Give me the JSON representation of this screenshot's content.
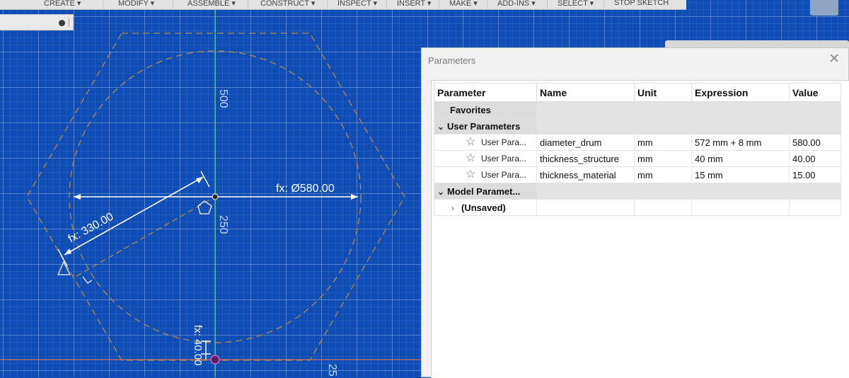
{
  "toolbar": {
    "menus": [
      "CREATE ▾",
      "MODIFY ▾",
      "ASSEMBLE ▾",
      "CONSTRUCT ▾",
      "INSPECT ▾",
      "INSERT ▾",
      "MAKE ▾",
      "ADD-INS ▾",
      "SELECT ▾",
      "STOP SKETCH"
    ]
  },
  "sketch": {
    "dimension_diameter": "fx: Ø580.00",
    "dimension_diagonal": "fx: 330.00",
    "dimension_bottom": "fx: 40.00",
    "axis_label_500": "500",
    "axis_label_250": "250",
    "axis_label_25": "25",
    "colors": {
      "canvas": "#0d4db5",
      "construction": "#b58a4a",
      "axis_y": "#4fd66a",
      "axis_x": "#d9705a"
    }
  },
  "dialog": {
    "title": "Parameters",
    "columns": [
      "Parameter",
      "Name",
      "Unit",
      "Expression",
      "Value"
    ],
    "groups": {
      "favorites": "Favorites",
      "user": "User Parameters",
      "model": "Model Paramet...",
      "unsaved": "(Unsaved)"
    },
    "user_rows": [
      {
        "parameter": "User Para...",
        "name": "diameter_drum",
        "unit": "mm",
        "expression": "572 mm + 8 mm",
        "value": "580.00"
      },
      {
        "parameter": "User Para...",
        "name": "thickness_structure",
        "unit": "mm",
        "expression": "40 mm",
        "value": "40.00"
      },
      {
        "parameter": "User Para...",
        "name": "thickness_material",
        "unit": "mm",
        "expression": "15 mm",
        "value": "15.00"
      }
    ]
  }
}
